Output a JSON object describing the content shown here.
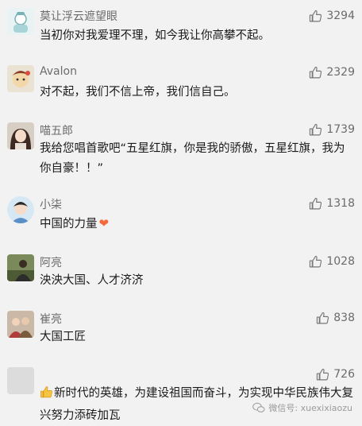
{
  "comments": [
    {
      "name": "莫让浮云遮望眼",
      "likes": "3294",
      "text": "当初你对我爱理不理，如今我让你高攀不起。"
    },
    {
      "name": "Avalon",
      "likes": "2329",
      "text": "对不起，我们不信上帝，我们信自己。"
    },
    {
      "name": "喵五郎",
      "likes": "1739",
      "text": "我给您唱首歌吧“五星红旗，你是我的骄傲，五星红旗，我为你自豪！！”"
    },
    {
      "name": "小柒",
      "likes": "1318",
      "text": "中国的力量"
    },
    {
      "name": "阿亮",
      "likes": "1028",
      "text": "泱泱大国、人才济济"
    },
    {
      "name": "崔亮",
      "likes": "838",
      "text": "大国工匠"
    },
    {
      "name": "",
      "likes": "726",
      "text": "新时代的英雄，为建设祖国而奋斗，为实现中华民族伟大复兴努力添砖加瓦"
    }
  ],
  "watermark": "微信号: xuexixiaozu",
  "icons": {
    "like": "thumbs-up-icon",
    "heart": "heart-emoji",
    "thumb_emoji": "thumbs-up-emoji",
    "wechat": "wechat-icon"
  }
}
